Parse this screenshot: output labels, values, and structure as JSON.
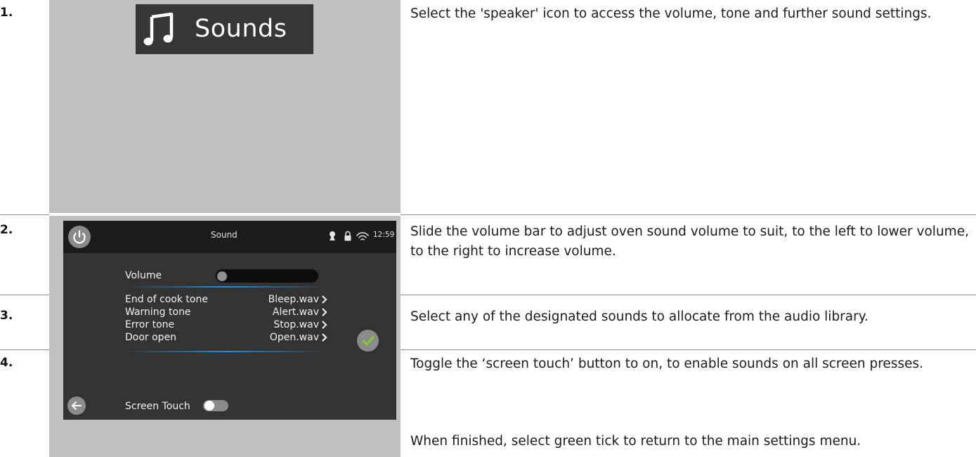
{
  "steps": [
    {
      "number": "1.",
      "text": "Select the 'speaker' icon to access the volume, tone and further sound settings."
    },
    {
      "number": "2.",
      "text": "Slide the volume bar to adjust oven sound volume to suit, to the left to lower volume, to the right to increase volume."
    },
    {
      "number": "3.",
      "text": "Select any of the designated sounds to allocate from the audio library."
    },
    {
      "number": "4.",
      "text": "Toggle the ‘screen touch’ button to on, to enable sounds on all screen presses."
    }
  ],
  "finish_text": "When finished, select green tick to return to the main settings menu.",
  "sounds_tile": {
    "icon": "music-note-icon",
    "label": "Sounds"
  },
  "device": {
    "title": "Sound",
    "status": {
      "icons": [
        "chef-icon",
        "lock-icon",
        "wifi-icon"
      ],
      "time": "12:59"
    },
    "volume": {
      "label": "Volume",
      "level": 0
    },
    "tones": [
      {
        "label": "End of cook tone",
        "value": "Bleep.wav"
      },
      {
        "label": "Warning tone",
        "value": "Alert.wav"
      },
      {
        "label": "Error tone",
        "value": "Stop.wav"
      },
      {
        "label": "Door open",
        "value": "Open.wav"
      }
    ],
    "screen_touch": {
      "label": "Screen Touch",
      "state": "off"
    },
    "buttons": {
      "power": "power-icon",
      "confirm": "check-icon",
      "back": "back-arrow-icon"
    }
  },
  "colors": {
    "panel_grey": "#c0c0c0",
    "screen_bg": "#333333",
    "topbar_bg": "#1c1c1c",
    "accent_blue": "#1e8fe0",
    "tick_green": "#7ed321"
  }
}
